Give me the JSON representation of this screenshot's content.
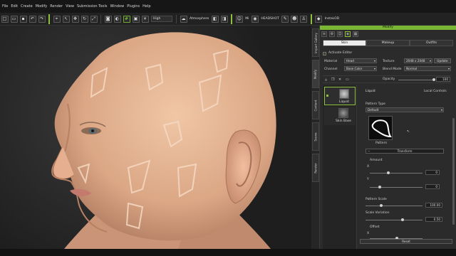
{
  "menu": [
    "File",
    "Edit",
    "Create",
    "Modify",
    "Render",
    "View",
    "Submission Tools",
    "Window",
    "Plugins",
    "Help"
  ],
  "toolbar": {
    "quality": "High",
    "atmosphere": "Atmosphere",
    "headshot": "HEADSHOT",
    "plugin": "InstaLOD",
    "mode_label": "Mi"
  },
  "side_tabs": [
    "Import Gallery",
    "Modify",
    "Content",
    "Scene",
    "Render"
  ],
  "panel": {
    "title": "Modify",
    "tabs": [
      "Skin",
      "Makeup",
      "Outfits"
    ],
    "activate_editor": "Activate Editor",
    "material_label": "Material",
    "material_value": "Head",
    "texture_label": "Texture",
    "texture_value": "2048 x 2048",
    "update_label": "Update",
    "channel_label": "Channel",
    "channel_value": "Base Color",
    "blend_label": "Blend Mode",
    "blend_value": "Normal",
    "opacity_label": "Opacity",
    "opacity_value": "100",
    "layers": [
      {
        "name": "Liquid",
        "active": true
      },
      {
        "name": "Skin Base",
        "active": false
      }
    ],
    "layer_name": "Liquid",
    "local_controls": "Local Controls",
    "pattern_type_label": "Pattern Type",
    "pattern_type_value": "Default",
    "pattern_label": "Pattern",
    "transform_label": "Transform",
    "amount_label": "Amount",
    "x_label": "X",
    "x_value": "0",
    "y_label": "Y",
    "y_value": "0",
    "pattern_scale_label": "Pattern Scale",
    "pattern_scale_value": "100.00",
    "scale_variation_label": "Scale Variation",
    "scale_variation_value": "0.50",
    "offset_label": "Offset",
    "offset_x_label": "X",
    "reset_label": "Reset"
  },
  "colors": {
    "accent": "#8bc13b",
    "panel_bg": "#2b2b2b",
    "skin": "#e7b896"
  }
}
